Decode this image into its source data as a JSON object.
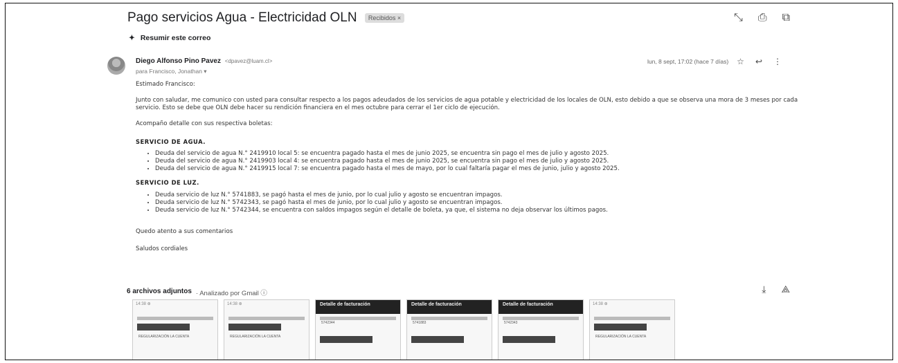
{
  "email": {
    "subject": "Pago servicios Agua - Electricidad OLN",
    "label": "Recibidos ×",
    "summarize": "Resumir este correo",
    "sender_name": "Diego Alfonso Pino Pavez",
    "sender_email": "<dpavez@luam.cl>",
    "to_line": "para Francisco, Jonathan ▾",
    "date": "lun, 8 sept, 17:02 (hace 7 días)"
  },
  "icons": {
    "top": [
      "expand-icon",
      "print-icon",
      "open-new-window-icon"
    ],
    "meta": [
      "star-icon",
      "reply-icon",
      "more-vert-icon"
    ],
    "attach": [
      "download-all-icon",
      "add-to-drive-icon"
    ]
  },
  "body": {
    "greeting": "Estimado Francisco:",
    "para1": "Junto con saludar, me comunico con usted para consultar respecto a los pagos adeudados de los servicios de agua potable y electricidad de los locales de OLN, esto debido a que se observa una mora de 3 meses por cada servicio. Esto se debe que OLN debe hacer su rendición financiera en el mes octubre para cerrar el 1er ciclo de ejecución.",
    "para2": "Acompaño detalle con sus respectiva boletas:",
    "water_heading": "SERVICIO DE AGUA.",
    "water_items": [
      "Deuda del servicio de agua N.° 2419910 local 5: se encuentra pagado hasta el mes de junio 2025, se encuentra sin pago el mes de julio y agosto 2025.",
      "Deuda del servicio de agua N.° 2419903 local 4: se encuentra pagado hasta el mes de junio 2025, se encuentra sin pago el mes de julio y agosto 2025.",
      "Deuda del servicio de agua N.° 2419915 local 7: se encuentra pagado hasta el mes de mayo, por lo cual faltaría pagar el mes de junio, julio y agosto 2025."
    ],
    "light_heading": "SERVICIO DE LUZ.",
    "light_items": [
      "Deuda servicio de luz N.° 5741883, se pagó hasta el mes de junio, por lo cual julio y agosto se encuentran impagos.",
      "Deuda servicio de luz N.° 5742343, se pagó hasta el mes de junio, por lo cual julio y agosto se encuentran impagos.",
      "Deuda servicio de luz N.° 5742344, se encuentra con saldos impagos según el detalle de boleta, ya que, el sistema no deja observar los últimos pagos."
    ],
    "closing1": "Quedo atento a sus comentarios",
    "closing2": "Saludos cordiales"
  },
  "attachments": {
    "title": "6 archivos adjuntos",
    "subtitle": "· Analizado por Gmail ⓘ",
    "items": [
      {
        "style": "light",
        "header": "14:38 ⊕",
        "caption": "REGULARIZACIÓN LA CUENTA"
      },
      {
        "style": "light",
        "header": "14:38 ⊕",
        "caption": "REGULARIZACIÓN LA CUENTA"
      },
      {
        "style": "dark",
        "header": "Detalle de facturación",
        "caption": "5742344"
      },
      {
        "style": "dark",
        "header": "Detalle de facturación",
        "caption": "5741883"
      },
      {
        "style": "dark",
        "header": "Detalle de facturación",
        "caption": "5742343"
      },
      {
        "style": "light",
        "header": "14:38 ⊕",
        "caption": "REGULARIZACIÓN LA CUENTA"
      }
    ]
  }
}
